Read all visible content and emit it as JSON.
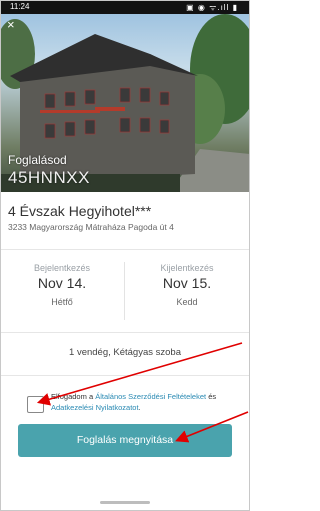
{
  "statusbar": {
    "time": "11:24",
    "icons": "▣ ◉ ᯤ.ıll ▮"
  },
  "close_icon": "×",
  "hero": {
    "booking_label": "Foglalásod",
    "booking_code": "45HNNXX"
  },
  "hotel": {
    "name": "4 Évszak Hegyihotel***",
    "address": "3233 Magyarország Mátraháza Pagoda út 4"
  },
  "dates": {
    "checkin": {
      "label": "Bejelentkezés",
      "date": "Nov 14.",
      "day": "Hétfő"
    },
    "checkout": {
      "label": "Kijelentkezés",
      "date": "Nov 15.",
      "day": "Kedd"
    }
  },
  "guests": "1 vendég, Kétágyas szoba",
  "consent": {
    "prefix": "Elfogadom a ",
    "terms_link": "Általános Szerződési Feltételeket",
    "middle": " és ",
    "privacy_link": "Adatkezelési Nyilatkozatot",
    "suffix": "."
  },
  "submit_label": "Foglalás megnyitása",
  "colors": {
    "accent": "#4aa3ad",
    "link": "#2a8ab3",
    "arrow": "#e00000"
  }
}
